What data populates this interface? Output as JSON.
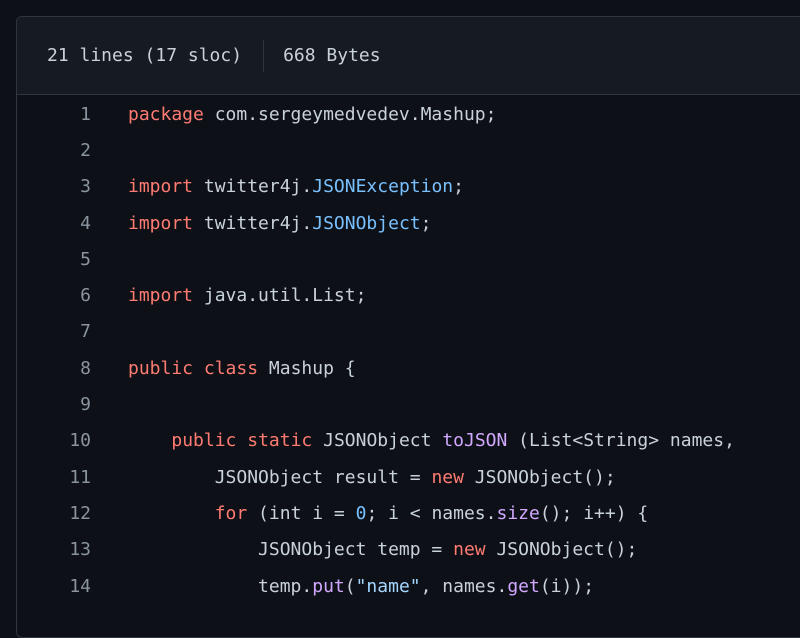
{
  "file_info": {
    "lines": "21 lines (17 sloc)",
    "size": "668 Bytes"
  },
  "code_lines": [
    {
      "n": "1",
      "tokens": [
        {
          "t": "package",
          "c": "kw"
        },
        {
          "t": " com.sergeymedvedev.Mashup;"
        }
      ]
    },
    {
      "n": "2",
      "tokens": []
    },
    {
      "n": "3",
      "tokens": [
        {
          "t": "import",
          "c": "kw"
        },
        {
          "t": " twitter4j."
        },
        {
          "t": "JSONException",
          "c": "ty"
        },
        {
          "t": ";"
        }
      ]
    },
    {
      "n": "4",
      "tokens": [
        {
          "t": "import",
          "c": "kw"
        },
        {
          "t": " twitter4j."
        },
        {
          "t": "JSONObject",
          "c": "ty"
        },
        {
          "t": ";"
        }
      ]
    },
    {
      "n": "5",
      "tokens": []
    },
    {
      "n": "6",
      "tokens": [
        {
          "t": "import",
          "c": "kw"
        },
        {
          "t": " java.util.List;"
        }
      ]
    },
    {
      "n": "7",
      "tokens": []
    },
    {
      "n": "8",
      "tokens": [
        {
          "t": "public",
          "c": "kw"
        },
        {
          "t": " "
        },
        {
          "t": "class",
          "c": "kw"
        },
        {
          "t": " Mashup {"
        }
      ]
    },
    {
      "n": "9",
      "tokens": []
    },
    {
      "n": "10",
      "tokens": [
        {
          "t": "    "
        },
        {
          "t": "public",
          "c": "kw"
        },
        {
          "t": " "
        },
        {
          "t": "static",
          "c": "kw"
        },
        {
          "t": " JSONObject "
        },
        {
          "t": "toJSON",
          "c": "fn"
        },
        {
          "t": " (List<String> names,"
        }
      ]
    },
    {
      "n": "11",
      "tokens": [
        {
          "t": "        JSONObject result = "
        },
        {
          "t": "new",
          "c": "kw"
        },
        {
          "t": " JSONObject();"
        }
      ]
    },
    {
      "n": "12",
      "tokens": [
        {
          "t": "        "
        },
        {
          "t": "for",
          "c": "kw"
        },
        {
          "t": " (int i = "
        },
        {
          "t": "0",
          "c": "num"
        },
        {
          "t": "; i < names."
        },
        {
          "t": "size",
          "c": "fn"
        },
        {
          "t": "(); i++) {"
        }
      ]
    },
    {
      "n": "13",
      "tokens": [
        {
          "t": "            JSONObject temp = "
        },
        {
          "t": "new",
          "c": "kw"
        },
        {
          "t": " JSONObject();"
        }
      ]
    },
    {
      "n": "14",
      "tokens": [
        {
          "t": "            temp."
        },
        {
          "t": "put",
          "c": "fn"
        },
        {
          "t": "("
        },
        {
          "t": "\"name\"",
          "c": "str"
        },
        {
          "t": ", names."
        },
        {
          "t": "get",
          "c": "fn"
        },
        {
          "t": "(i));"
        }
      ]
    }
  ],
  "colors": {
    "background": "#0d1117",
    "header_background": "#161b22",
    "border": "#30363d",
    "text": "#c9d1d9",
    "line_number": "#8b949e",
    "keyword": "#ff7b72",
    "type": "#79c0ff",
    "function": "#d2a8ff",
    "string": "#a5d6ff"
  }
}
